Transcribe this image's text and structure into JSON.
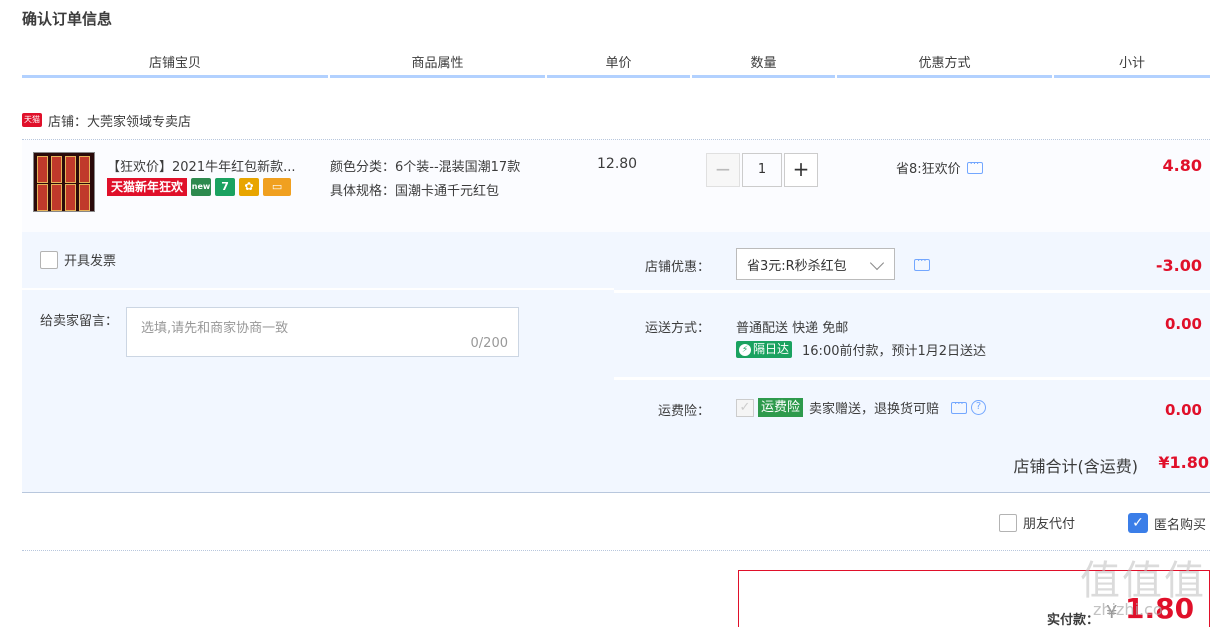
{
  "page": {
    "title": "确认订单信息"
  },
  "columns": [
    "店铺宝贝",
    "商品属性",
    "单价",
    "数量",
    "优惠方式",
    "小计"
  ],
  "shop": {
    "badge": "天猫",
    "label": "店铺：大莞家领域专卖店"
  },
  "item": {
    "title": "【狂欢价】2021牛年红包新款...",
    "tag_promo": "天猫新年狂欢",
    "tag_icons": [
      {
        "name": "new-icon",
        "text": "new",
        "color": "#2d8a4e"
      },
      {
        "name": "seven-day-icon",
        "text": "7",
        "color": "#1aa260"
      },
      {
        "name": "guarantee-icon",
        "text": "✿",
        "color": "#e8a500"
      },
      {
        "name": "card-icon",
        "text": "▭",
        "color": "#f0a020"
      }
    ],
    "attr_color": "颜色分类：6个装--混装国潮17款",
    "attr_spec": "具体规格：国潮卡通千元红包",
    "price": "12.80",
    "quantity": "1",
    "discount": "省8:狂欢价",
    "subtotal": "4.80"
  },
  "invoice": {
    "label": "开具发票"
  },
  "note": {
    "label": "给卖家留言：",
    "placeholder": "选填,请先和商家协商一致",
    "count": "0/200"
  },
  "shop_discount": {
    "label": "店铺优惠：",
    "selected": "省3元:R秒杀红包",
    "amount": "-3.00"
  },
  "shipping": {
    "label": "运送方式：",
    "method": "普通配送 快递 免邮",
    "badge": "隔日达",
    "eta": "16:00前付款，预计1月2日送达",
    "amount": "0.00"
  },
  "insurance": {
    "label": "运费险：",
    "tag": "运费险",
    "desc": "卖家赠送，退换货可赔",
    "amount": "0.00"
  },
  "total": {
    "label": "店铺合计(含运费)",
    "value": "¥1.80"
  },
  "options": {
    "friend_pay": "朋友代付",
    "anonymous": "匿名购买"
  },
  "payment": {
    "label": "实付款：",
    "currency": "¥",
    "value": "1.80"
  },
  "watermark": {
    "logo": "值值值",
    "site": "zhizhi.co"
  },
  "colors": {
    "accent_red": "#e0102a",
    "panel_bg": "#f2f7ff",
    "header_line": "#b2d1ff",
    "check_blue": "#3b7ee8"
  }
}
